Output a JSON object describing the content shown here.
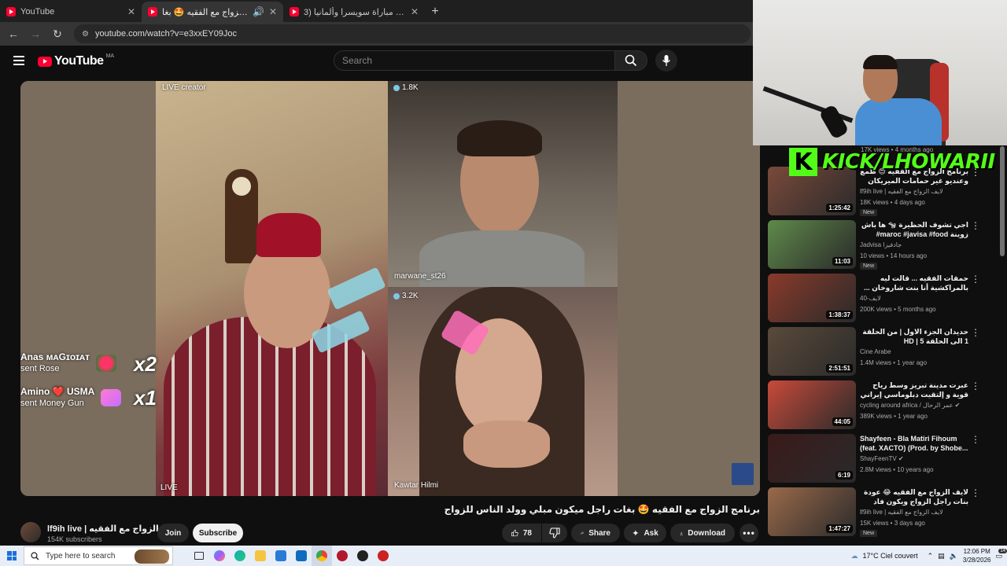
{
  "browser": {
    "tabs": [
      {
        "title": "YouTube",
        "active": false
      },
      {
        "title": "برنامج الزواج مع الفقيه 🤩 بغا...",
        "active": true
      },
      {
        "title": "ملخص مباراة سويسرا وألمانيا (3-...",
        "active": false
      }
    ],
    "url": "youtube.com/watch?v=e3xxEY09Joc"
  },
  "yt": {
    "logo": "YouTube",
    "country": "MA",
    "search_placeholder": "Search"
  },
  "player": {
    "live_creator_label": "LIVE creator",
    "badge_top": "1.8K",
    "badge_bottom": "3.2K",
    "name_top": "marwane_st26",
    "name_bottom": "Kawtar Hilmi",
    "name_left": "LIVE",
    "gifts": [
      {
        "user": "Anas ᴍᴀGɪoɪᴀᴛ",
        "action": "sent Rose",
        "multiplier": "x2"
      },
      {
        "user": "Amino ❤️ USMA",
        "action": "sent Money Gun",
        "multiplier": "x1"
      }
    ]
  },
  "video": {
    "title": "برنامج الزواج مع الفقيه 🤩 بغات راجل ميكون مبلي وولد الناس للزواج",
    "channel_name": "lf9ih live | لايف الزواج مع الفقيه",
    "subscribers": "154K subscribers",
    "join_label": "Join",
    "subscribe_label": "Subscribe",
    "likes": "78",
    "share_label": "Share",
    "ask_label": "Ask",
    "download_label": "Download"
  },
  "kick_banner": {
    "letter": "K",
    "text": "KICK/LHOWARII"
  },
  "sidebar": {
    "top_meta": "17K views • 4 months ago",
    "recommendations": [
      {
        "title": "برنامج الزواج مع الفقيه 😍 طمع وعنديو غير حمامات الميريكان وهي توافق 😂 الموت ديال",
        "channel": "lf9ih live | لايف الزواج مع الفقيه",
        "views": "18K views • 4 days ago",
        "duration": "1:25:42",
        "new": "New",
        "rtl": true,
        "thumb": "#7a4a3a"
      },
      {
        "title": "اجي تشوف الحظيرة 🐄 ها باش زوينة maroc #javisa #food# الحروبية",
        "channel": "Jadvisa جادفيزا",
        "views": "10 views • 14 hours ago",
        "duration": "11:03",
        "new": "New",
        "rtl": true,
        "thumb": "#5f8a4a"
      },
      {
        "title": "حمقات الفقيه ... قالت ليه بالمراكشية أنا بنت شاروخان ... الناس لي عايشين في اوروبا",
        "channel": "لايف-40",
        "views": "200K views • 5 months ago",
        "duration": "1:38:37",
        "new": "",
        "rtl": true,
        "thumb": "#8a3a2a"
      },
      {
        "title": "حديدان الجزء الاول | من الحلقة 1 الى الحلقة 5 | HD",
        "channel": "Cine Arabe",
        "views": "1.4M views • 1 year ago",
        "duration": "2:51:51",
        "new": "",
        "rtl": true,
        "thumb": "#5a4a3a"
      },
      {
        "title": "عبرت مدينة تبريز وسط رياح قوية و إلتقيت دبلوماسي إيراني 🇮🇷 IRMA",
        "channel": "cycling around africa / عمر الرحال ✔",
        "views": "389K views • 1 year ago",
        "duration": "44:05",
        "new": "",
        "rtl": true,
        "thumb": "#c84a3a"
      },
      {
        "title": "Shayfeen - Bla Matiri Fihoum (feat. XACTO) (Prod. by Shobe...",
        "channel": "ShayFeenTV ✔",
        "views": "2.8M views • 10 years ago",
        "duration": "6:19",
        "new": "",
        "rtl": false,
        "thumb": "#3a1a1a"
      },
      {
        "title": "لايف الزواج مع الفقيه 😂 عودة بنات راجل الزواج ويكون فاد بها!! الفقيه داخ 😂",
        "channel": "lf9ih live | لايف الزواج مع الفقيه",
        "views": "15K views • 3 days ago",
        "duration": "1:47:27",
        "new": "New",
        "rtl": true,
        "thumb": "#9a6a4a"
      }
    ]
  },
  "taskbar": {
    "search_placeholder": "Type here to search",
    "weather": "17°C  Ciel couvert",
    "time": "12:06 PM",
    "date": "3/28/2026",
    "notif_count": "14"
  }
}
